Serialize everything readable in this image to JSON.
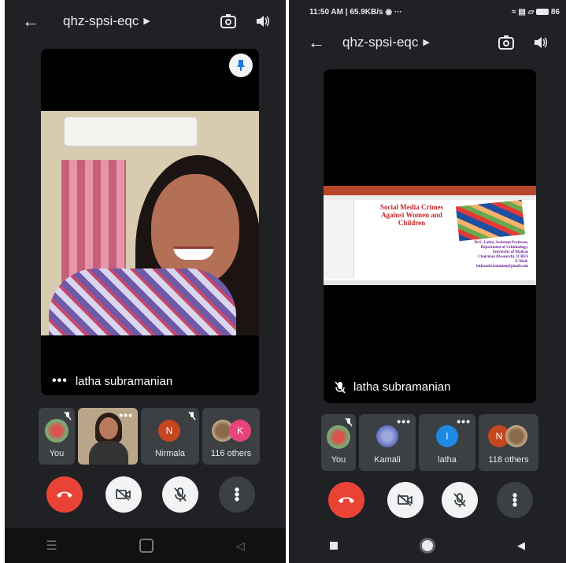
{
  "left": {
    "meeting_code": "qhz-spsi-eqc",
    "speaker_name": "latha subramanian",
    "participants": [
      {
        "label": "You"
      },
      {
        "label": ""
      },
      {
        "label": "Nirmala",
        "initial": "N"
      },
      {
        "label": "116 others",
        "initial": "K"
      }
    ]
  },
  "right": {
    "status_time": "11:50 AM | 65.9KB/s",
    "status_battery": "86",
    "meeting_code": "qhz-spsi-eqc",
    "speaker_name": "latha subramanian",
    "slide": {
      "title": "Social Media Crimes Against Women and Children",
      "author_lines": [
        "Dr.S. Latha, Assistant Professor,",
        "Department of Criminology,",
        "University of Madras",
        "Chairman (Research), ICRES",
        "E-Mail:",
        "lathasubramanian@gmail.com"
      ]
    },
    "participants": [
      {
        "label": "You"
      },
      {
        "label": "Kamali"
      },
      {
        "label": "latha",
        "initial": "l"
      },
      {
        "label": "118 others",
        "initial": "N"
      }
    ]
  },
  "colors": {
    "app_bg": "#202124",
    "end_call": "#ea4335",
    "tile_bg": "#3c4043",
    "slide_title": "#c62828",
    "slide_accent": "#b7472a",
    "avatar_n": "#c5461f",
    "avatar_k": "#e8447a",
    "avatar_l": "#1e88e5"
  },
  "icons": [
    "back-arrow-icon",
    "caret-icon",
    "switch-camera-icon",
    "speaker-icon",
    "pin-icon",
    "more-dots-icon",
    "mic-off-icon",
    "end-call-icon",
    "camera-off-icon",
    "more-vert-icon",
    "wifi-icon",
    "battery-icon"
  ]
}
